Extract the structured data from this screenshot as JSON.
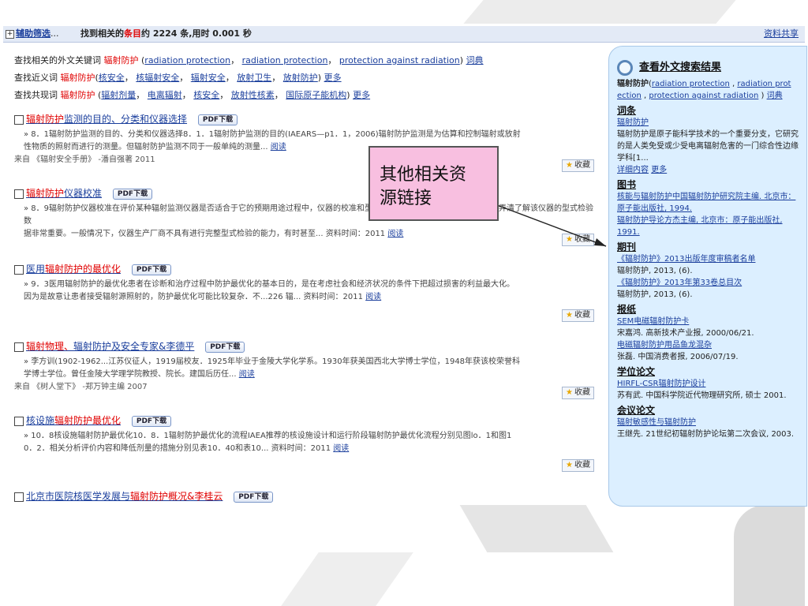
{
  "topbar": {
    "plus": "+",
    "filter_label": "辅助筛选",
    "ellipsis": "...",
    "summary_pre": "找到相关的",
    "summary_hl": "条目",
    "summary_post": "约 2224 条,用时 0.001 秒",
    "share_label": "资料共享"
  },
  "keywords": {
    "line1": {
      "pre": "查找相关的外文关键词",
      "term": "辐射防护",
      "open": " (",
      "links": [
        "radiation protection",
        "radiation protection",
        "protection against radiation"
      ],
      "close": ")",
      "dict": "词典"
    },
    "line2": {
      "pre": "查找近义词",
      "term": "辐射防护",
      "open": "(",
      "links": [
        "核安全",
        "核辐射安全",
        "辐射安全",
        "放射卫生",
        "放射防护"
      ],
      "close": ")",
      "more": "更多"
    },
    "line3": {
      "pre": "查找共现词",
      "term": "辐射防护",
      "open": " (",
      "links": [
        "辐射剂量",
        "电离辐射",
        "核安全",
        "放射性核素",
        "国际原子能机构"
      ],
      "close": ")",
      "more": "更多"
    }
  },
  "results": [
    {
      "title_a": "辐射防护",
      "title_b": "监测的目的、分类和仪器选择",
      "pdf": "PDF下载",
      "body1": "» 8．1辐射防护监测的目的、分类和仪器选择8．1．1辐射防护监测的目的(IAEARS—p1．1，2006)辐射防护监测是为估算和控制辐射或放射",
      "body2": "性物质的照射而进行的测量。但辐射防护监测不同于一般单纯的测量...",
      "read": "阅读",
      "src": "来自 《辐射安全手册》 -潘自强著 2011",
      "fav": "收藏"
    },
    {
      "title_a": "辐射防护",
      "title_b": "仪器校准",
      "pdf": "PDF下载",
      "body1": "» 8．9辐射防护仪器校准在评价某种辐射监测仪器是否适合于它的预期用途过程中，仪器的校准和型式检验工作十分重要。在购买之前，弄清了解该仪器的型式检验数",
      "body2": "据非常重要。一般情况下，仪器生产厂商不具有进行完整型式检验的能力，有时甚至... 资料时间：2011",
      "read": "阅读",
      "src": "",
      "fav": "收藏"
    },
    {
      "title_a": "医用",
      "title_b": "辐射防护的最优化",
      "pdf": "PDF下载",
      "body1": "» 9．3医用辐射防护的最优化患者在诊断和治疗过程中防护最优化的基本日的，是在考虑社会和经济状况的条件下把超过损害的利益最大化。",
      "body2": "因为是故意让患者接受辐射源照射的，防护最优化可能比较复杂．不...226 辐... 资料时间：2011",
      "read": "阅读",
      "src": "",
      "fav": "收藏"
    },
    {
      "title_a": "辐射物理、",
      "title_b": "辐射防护及安全专家&李德平",
      "pdf": "PDF下载",
      "body1": "» 李方训(1902-1962...江苏仪征人，1919届校友．1925年毕业于金陵大学化学系。1930年获美国西北大学博士学位，1948年获该校荣誉科",
      "body2": "学博士学位。曾任金陵大学理学院教授、院长。建国后历任...",
      "read": "阅读",
      "src": "来自 《树人堂下》 -郑万钟主编 2007",
      "fav": "收藏"
    },
    {
      "title_a": "核设施",
      "title_b": "辐射防护最优化",
      "pdf": "PDF下载",
      "body1": "» 10．8核设施辐射防护最优化10．8．1辐射防护最优化的流程IAEA推荐的核设施设计和运行阶段辐射防护最优化流程分别见图lo．1和图1",
      "body2": "0．2．相关分析评价内容和降低剂量的措施分别见表10．40和表10... 资料时间：2011",
      "read": "阅读",
      "src": "",
      "fav": "收藏"
    },
    {
      "title_a": "北京市医院核医学发展与",
      "title_b": "辐射防护概况&李桂云",
      "pdf": "PDF下载",
      "body1": "",
      "body2": "",
      "read": "",
      "src": "",
      "fav": ""
    }
  ],
  "sidebar": {
    "header": "查看外文搜索结果",
    "term": "辐射防护",
    "links": [
      "radiation protection",
      "radiation prot",
      "ection",
      "protection against radiation"
    ],
    "dict": "词典",
    "sec_cizhao": "词条",
    "cizhao_link": "辐射防护",
    "cizhao_text": "辐射防护是原子能科学技术的一个重要分支，它研究的是人类免受或少受电离辐射危害的一门综合性边缘学科[1...",
    "detail": "详细内容",
    "more": "更多",
    "sec_books": "图书",
    "book1": "核能与辐射防护中国辐射防护研究院主编. 北京市：原子能出版社, 1994.",
    "book2": "辐射防护导论方杰主编, 北京市：原子能出版社, 1991.",
    "sec_journal": "期刊",
    "j1": "《辐射防护》2013出版年度审稿者名单",
    "j1src": "辐射防护, 2013, (6).",
    "j2": "《辐射防护》2013年第33卷总目次",
    "j2src": "辐射防护, 2013, (6).",
    "sec_news": "报纸",
    "n1": "SEM电磁辐射防护卡",
    "n1src": "宋嘉鸿. 高新技术产业报, 2000/06/21.",
    "n2": "电磁辐射防护用品鱼龙混杂",
    "n2src": "张磊. 中国消费者报, 2006/07/19.",
    "sec_thesis": "学位论文",
    "t1": "HIRFL-CSR辐射防护设计",
    "t1src": "苏有武. 中国科学院近代物理研究所, 硕士 2001.",
    "sec_conf": "会议论文",
    "c1": "辐射敏感性与辐射防护",
    "c1src": "王继先. 21世纪初辐射防护论坛第二次会议, 2003."
  },
  "callout": {
    "line1": "其他相关资",
    "line2": "源链接"
  }
}
